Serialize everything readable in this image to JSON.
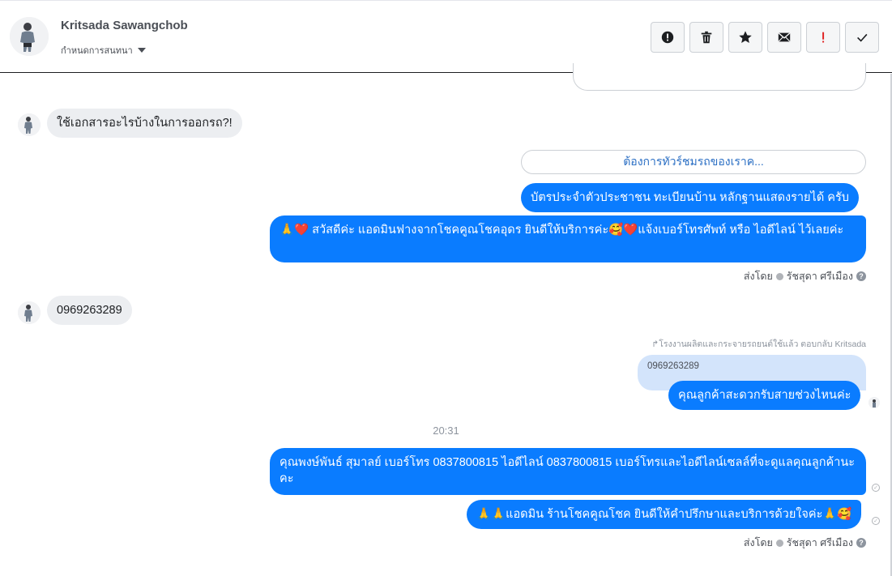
{
  "header": {
    "name": "Kritsada Sawangchob",
    "assign_label": "กำหนดการสนทนา"
  },
  "actions": [
    {
      "icon": "alert-circle-icon"
    },
    {
      "icon": "trash-icon"
    },
    {
      "icon": "star-icon"
    },
    {
      "icon": "envelope-icon"
    },
    {
      "icon": "exclamation-icon"
    },
    {
      "icon": "checkmark-icon"
    }
  ],
  "messages": {
    "incoming_1": "ใช้เอกสารอะไรบ้างในการออกรถ?!",
    "button_card": "ต้องการทัวร์ชมรถของเราค...",
    "out_1": "บัตรประจำตัวประชาชน ทะเบียนบ้าน หลักฐานแสดงรายได้ ครับ",
    "out_2": "🙏❤️ สวัสดีค่ะ แอดมินฟางจากโชคคูณโชคอุดร ยินดีให้บริการค่ะ🥰❤️แจ้งเบอร์โทรศัพท์ หรือ ไอดีไลน์  ไว้เลยค่ะ",
    "incoming_2": "0969263289",
    "reply_note": "โรงงานผลิตและกระจายรถยนต์ใช้แล้ว ตอบกลับ Kritsada",
    "quoted": "0969263289",
    "out_3": "คุณลูกค้าสะดวกรับสายช่วงไหนค่ะ",
    "timestamp": "20:31",
    "out_4": "คุณพงษ์พันธ์ สุมาลย์      เบอร์โทร 0837800815  ไอดีไลน์ 0837800815   เบอร์โทรและไอดีไลน์เซลล์ที่จะดูแลคุณลูกค้านะคะ",
    "out_5": "🙏🙏แอดมิน ร้านโชคคูณโชค ยินดีให้คำปรึกษาและบริการด้วยใจค่ะ🙏🥰"
  },
  "sent_by": {
    "label": "ส่งโดย",
    "name": "รัชสุดา ศรีเมือง",
    "help": "?"
  },
  "colors": {
    "outgoing": "#0a7cff",
    "incoming": "#eceef1",
    "link": "#2b6fc4"
  }
}
